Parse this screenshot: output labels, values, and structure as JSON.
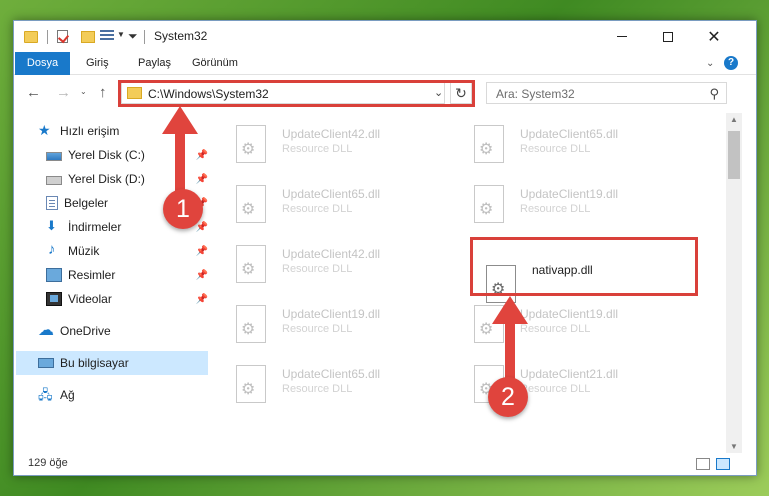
{
  "window": {
    "title": "System32"
  },
  "ribbon": {
    "tabs": [
      "Dosya",
      "Giriş",
      "Paylaş",
      "Görünüm"
    ],
    "help": "?"
  },
  "navbar": {
    "address": "C:\\Windows\\System32",
    "search_placeholder": "Ara: System32"
  },
  "sidebar": {
    "items": [
      {
        "label": "Hızlı erişim"
      },
      {
        "label": "Yerel Disk (C:)"
      },
      {
        "label": "Yerel Disk (D:)"
      },
      {
        "label": "Belgeler"
      },
      {
        "label": "İndirmeler"
      },
      {
        "label": "Müzik"
      },
      {
        "label": "Resimler"
      },
      {
        "label": "Videolar"
      },
      {
        "label": "OneDrive"
      },
      {
        "label": "Bu bilgisayar"
      },
      {
        "label": "Ağ"
      }
    ]
  },
  "files": [
    {
      "name": "UpdateClient42.dll",
      "type": "Resource DLL"
    },
    {
      "name": "UpdateClient65.dll",
      "type": "Resource DLL"
    },
    {
      "name": "UpdateClient65.dll",
      "type": "Resource DLL"
    },
    {
      "name": "UpdateClient19.dll",
      "type": "Resource DLL"
    },
    {
      "name": "UpdateClient42.dll",
      "type": "Resource DLL"
    },
    {
      "name": "nativapp.dll",
      "type": ""
    },
    {
      "name": "UpdateClient19.dll",
      "type": "Resource DLL"
    },
    {
      "name": "UpdateClient19.dll",
      "type": "Resource DLL"
    },
    {
      "name": "UpdateClient65.dll",
      "type": "Resource DLL"
    },
    {
      "name": "UpdateClient21.dll",
      "type": "Resource DLL"
    }
  ],
  "status": {
    "item_count": "129 öğe"
  },
  "annotations": {
    "step1": "1",
    "step2": "2",
    "color": "#e0443d"
  }
}
